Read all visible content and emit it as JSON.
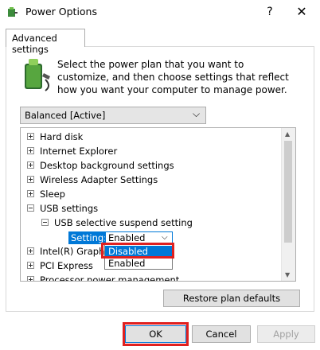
{
  "window": {
    "title": "Power Options",
    "help_glyph": "?",
    "close_glyph": "✕"
  },
  "tab": {
    "label": "Advanced settings"
  },
  "description": "Select the power plan that you want to customize, and then choose settings that reflect how you want your computer to manage power.",
  "plan_dropdown": {
    "value": "Balanced [Active]",
    "chevron": "⌵"
  },
  "tree": {
    "items": [
      {
        "label": "Hard disk",
        "expanded": false
      },
      {
        "label": "Internet Explorer",
        "expanded": false
      },
      {
        "label": "Desktop background settings",
        "expanded": false
      },
      {
        "label": "Wireless Adapter Settings",
        "expanded": false
      },
      {
        "label": "Sleep",
        "expanded": false
      },
      {
        "label": "USB settings",
        "expanded": true
      },
      {
        "label": "USB selective suspend setting",
        "expanded": true
      },
      {
        "label": "Intel(R) Graphics Settings",
        "visible_label": "Intel(R) Graphi",
        "expanded": false
      },
      {
        "label": "PCI Express",
        "expanded": false
      },
      {
        "label": "Processor power management",
        "expanded": false
      }
    ],
    "setting": {
      "label": "Setting:",
      "value": "Enabled",
      "chevron": "⌵"
    },
    "options": [
      "Disabled",
      "Enabled"
    ]
  },
  "buttons": {
    "restore": "Restore plan defaults",
    "ok": "OK",
    "cancel": "Cancel",
    "apply": "Apply"
  },
  "colors": {
    "accent": "#0078d7",
    "highlight": "#e0201f"
  }
}
